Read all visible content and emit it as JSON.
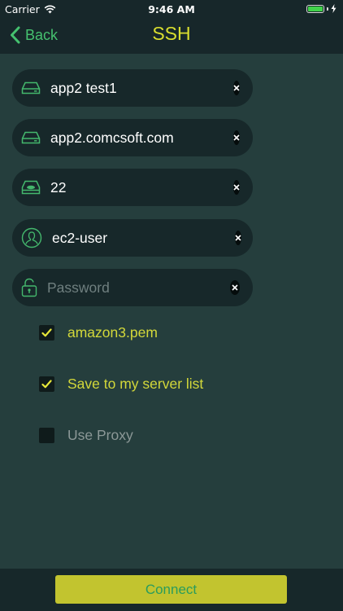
{
  "status_bar": {
    "carrier": "Carrier",
    "time": "9:46 AM"
  },
  "nav": {
    "back_label": "Back",
    "title": "SSH"
  },
  "fields": {
    "name": {
      "value": "app2 test1",
      "icon": "drive-icon"
    },
    "host": {
      "value": "app2.comcsoft.com",
      "icon": "drive-icon"
    },
    "port": {
      "value": "22",
      "icon": "drive-port-icon"
    },
    "username": {
      "value": "ec2-user",
      "icon": "user-icon"
    },
    "password": {
      "value": "",
      "placeholder": "Password",
      "icon": "lock-icon"
    }
  },
  "options": {
    "key_file": {
      "label": "amazon3.pem",
      "checked": true
    },
    "save_server": {
      "label": "Save to my server list",
      "checked": true
    },
    "use_proxy": {
      "label": "Use Proxy",
      "checked": false
    }
  },
  "bottom": {
    "connect_label": "Connect"
  },
  "colors": {
    "background": "#253e3d",
    "bar": "#17272a",
    "accent_green": "#45c16f",
    "title_yellow": "#d9de2f",
    "button_yellow": "#c2c42f",
    "button_text": "#2a9c5c"
  }
}
